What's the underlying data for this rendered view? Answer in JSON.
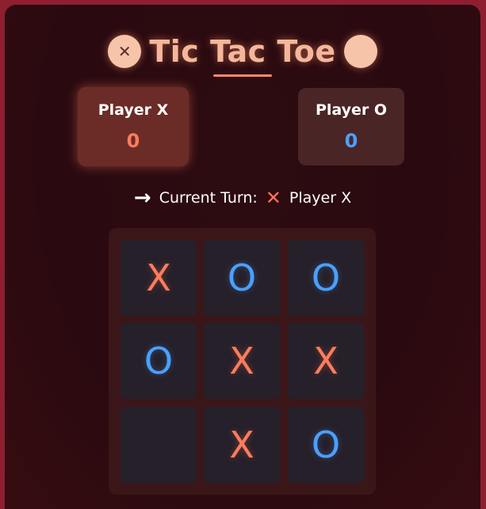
{
  "app": {
    "title": "Tic Tac Toe",
    "title_left_icon": "circle-x-icon",
    "title_right_icon": "circle-o-icon"
  },
  "scores": {
    "x": {
      "label": "Player X",
      "value": "0"
    },
    "o": {
      "label": "Player O",
      "value": "0"
    }
  },
  "turn": {
    "prefix": "Current Turn:",
    "mark": "✕",
    "player": "Player X",
    "arrow_icon": "arrow-right-icon"
  },
  "board": {
    "cells": [
      "X",
      "O",
      "O",
      "O",
      "X",
      "X",
      "",
      "X",
      "O"
    ]
  },
  "colors": {
    "x": "#ff7c5c",
    "o": "#4aa0ff",
    "background": "#2a0a10",
    "accent_border": "#8e1f30"
  }
}
